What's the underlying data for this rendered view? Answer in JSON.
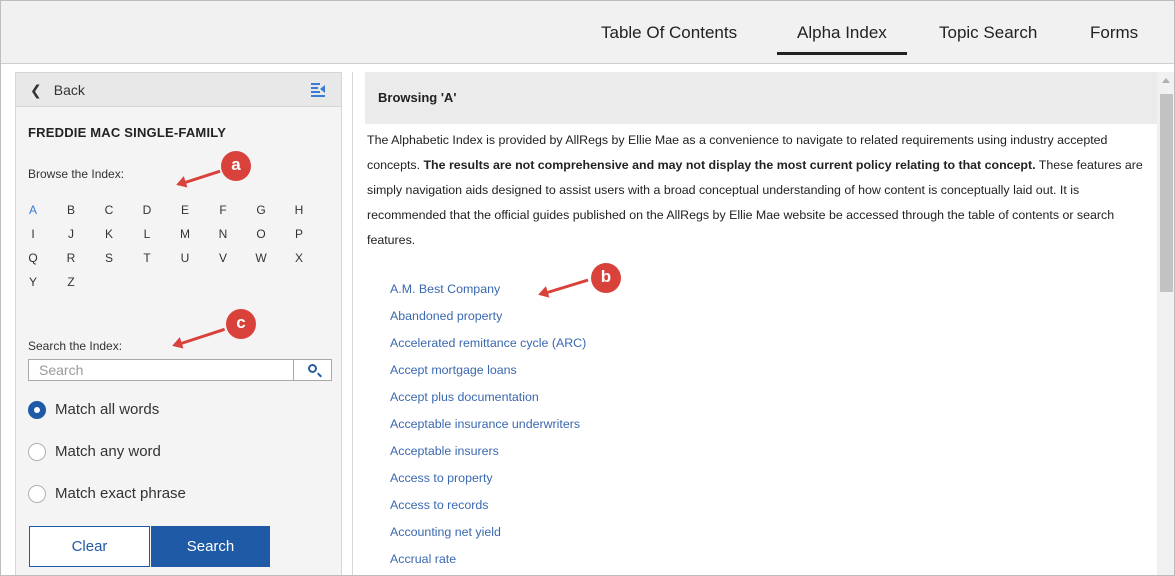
{
  "nav": {
    "tabs": [
      {
        "label": "Table Of Contents",
        "active": false
      },
      {
        "label": "Alpha Index",
        "active": true
      },
      {
        "label": "Topic Search",
        "active": false
      },
      {
        "label": "Forms",
        "active": false
      }
    ]
  },
  "sidebar": {
    "back_label": "Back",
    "collapse_icon": "collapse-panel-icon",
    "title": "FREDDIE MAC SINGLE-FAMILY",
    "browse_label": "Browse the Index:",
    "letters": [
      "A",
      "B",
      "C",
      "D",
      "E",
      "F",
      "G",
      "H",
      "I",
      "J",
      "K",
      "L",
      "M",
      "N",
      "O",
      "P",
      "Q",
      "R",
      "S",
      "T",
      "U",
      "V",
      "W",
      "X",
      "Y",
      "Z"
    ],
    "current_letter": "A",
    "search_label": "Search the Index:",
    "search_placeholder": "Search",
    "search_value": "",
    "match_options": [
      {
        "label": "Match all words",
        "selected": true
      },
      {
        "label": "Match any word",
        "selected": false
      },
      {
        "label": "Match exact phrase",
        "selected": false
      }
    ],
    "clear_label": "Clear",
    "search_button_label": "Search"
  },
  "main": {
    "browse_title": "Browsing 'A'",
    "intro_part1": "The Alphabetic Index is provided by AllRegs by Ellie Mae as a convenience to navigate to related requirements using industry accepted concepts. ",
    "intro_bold": "The results are not comprehensive and may not display the most current policy relating to that concept.",
    "intro_part2": " These features are simply navigation aids designed to assist users with a broad conceptual understanding of how content is conceptually laid out. It is recommended that the official guides published on the AllRegs by Ellie Mae website be accessed through the table of contents or search features.",
    "links": [
      "A.M. Best Company",
      "Abandoned property",
      "Accelerated remittance cycle (ARC)",
      "Accept mortgage loans",
      "Accept plus documentation",
      "Acceptable insurance underwriters",
      "Acceptable insurers",
      "Access to property",
      "Access to records",
      "Accounting net yield",
      "Accrual rate"
    ]
  },
  "callouts": [
    "a",
    "b",
    "c"
  ],
  "colors": {
    "accent": "#1f5aa6",
    "link": "#3a68b0",
    "callout": "#d9423b"
  }
}
